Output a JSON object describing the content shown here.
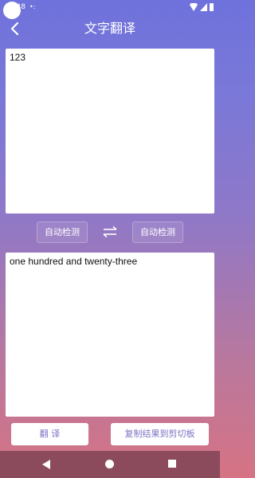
{
  "status": {
    "time": "11:48",
    "extra": "•:"
  },
  "header": {
    "title": "文字翻译",
    "back_icon": "chevron-left-icon"
  },
  "input": {
    "value": "123"
  },
  "languages": {
    "source": "自动检测",
    "target": "自动检测",
    "swap_icon": "swap-arrows-icon"
  },
  "output": {
    "value": "one hundred and twenty-three"
  },
  "actions": {
    "translate_label": "翻 译",
    "copy_label": "复制结果到剪切板"
  },
  "colors": {
    "accent": "#7b73c4",
    "navbar": "#8c4b5c"
  }
}
